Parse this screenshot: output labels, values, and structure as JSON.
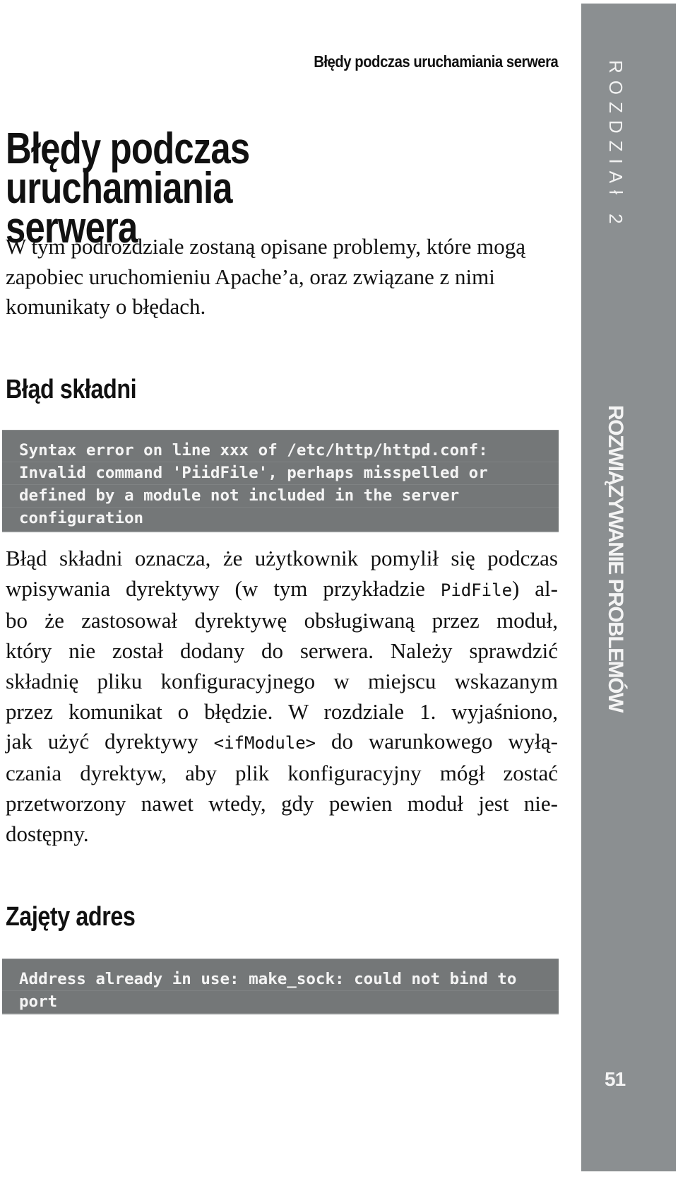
{
  "running_header": "Błędy podczas uruchamiania serwera",
  "title": {
    "line1": "Błędy podczas uruchamiania",
    "line2": "serwera"
  },
  "intro": "W tym podrozdziale zostaną opisane problemy, które mogą zapobiec uruchomieniu Apache’a, oraz związane z nimi komunikaty o błędach.",
  "sections": [
    {
      "heading": "Błąd składni",
      "code_lines": [
        "Syntax error on line xxx of /etc/http/httpd.conf:",
        "Invalid command 'PiidFile', perhaps misspelled or",
        "defined by a module not included in the server",
        "configuration"
      ],
      "body_lines": [
        [
          "Błąd składni oznacza, że użytkownik pomylił się podczas"
        ],
        [
          "wpisywania dyrektywy (w tym przykładzie ",
          "PidFile",
          ") al-"
        ],
        [
          "bo że zastosował dyrektywę obsługiwaną przez moduł,"
        ],
        [
          "który nie został dodany do serwera. Należy sprawdzić"
        ],
        [
          "składnię pliku konfiguracyjnego w miejscu wskazanym"
        ],
        [
          "przez komunikat o błędzie. W rozdziale 1. wyjaśniono,"
        ],
        [
          "jak użyć dyrektywy ",
          "<ifModule>",
          " do warunkowego wyłą-"
        ],
        [
          "czania dyrektyw, aby plik konfiguracyjny mógł zostać"
        ],
        [
          "przetworzony nawet wtedy, gdy pewien moduł jest nie-"
        ],
        [
          "dostępny."
        ]
      ]
    },
    {
      "heading": "Zajęty adres",
      "code_lines": [
        "Address already in use: make_sock: could not bind to",
        "port"
      ]
    }
  ],
  "sidebar": {
    "chapter_label": "ROZDZIAł 2",
    "section_label": "ROZWIĄZYWANIE PROBLEMÓW",
    "page_number": "51",
    "color": "#8b8f91"
  },
  "colors": {
    "code_background": "#747778",
    "code_text": "#f4f4f4",
    "text": "#111111"
  }
}
